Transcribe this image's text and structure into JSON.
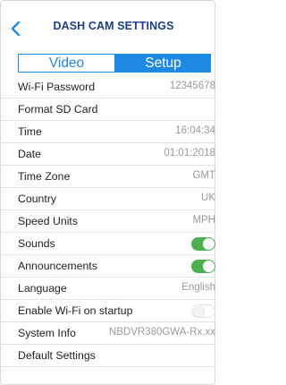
{
  "header": {
    "title": "DASH CAM SETTINGS"
  },
  "tabs": [
    {
      "label": "Video",
      "active": false
    },
    {
      "label": "Setup",
      "active": true
    }
  ],
  "colors": {
    "accent": "#1e88e5",
    "title": "#1b3f8a",
    "toggle_on": "#4caf50"
  },
  "settings": [
    {
      "label": "Wi-Fi Password",
      "value": "12345678"
    },
    {
      "label": "Format SD Card",
      "value": ""
    },
    {
      "label": "Time",
      "value": "16:04:34"
    },
    {
      "label": "Date",
      "value": "01:01:2018"
    },
    {
      "label": "Time Zone",
      "value": "GMT"
    },
    {
      "label": "Country",
      "value": "UK"
    },
    {
      "label": "Speed Units",
      "value": "MPH"
    },
    {
      "label": "Sounds",
      "toggle": true
    },
    {
      "label": "Announcements",
      "toggle": true
    },
    {
      "label": "Language",
      "value": "English"
    },
    {
      "label": "Enable Wi-Fi on startup",
      "toggle": false
    },
    {
      "label": "System Info",
      "value": "NBDVR380GWA-Rx.xx"
    },
    {
      "label": "Default Settings",
      "value": ""
    }
  ]
}
